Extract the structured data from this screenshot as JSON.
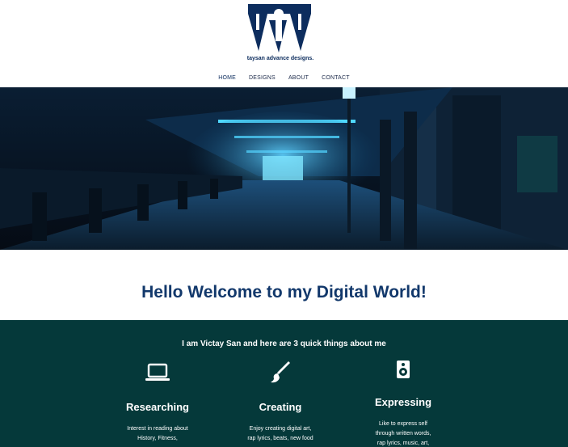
{
  "brand": {
    "name": "taysan advance designs.",
    "primary_color": "#0d2d5e"
  },
  "nav": {
    "items": [
      {
        "label": "HOME"
      },
      {
        "label": "DESIGNS"
      },
      {
        "label": "ABOUT"
      },
      {
        "label": "CONTACT"
      }
    ]
  },
  "hero": {
    "image": "night-corridor-blue-lights"
  },
  "welcome": {
    "title": "Hello Welcome to my Digital World!"
  },
  "about": {
    "intro": "I am Victay San and here are 3 quick things about me",
    "background_color": "#05393a",
    "features": [
      {
        "icon": "laptop-icon",
        "title": "Researching",
        "lines": [
          "Interest in reading about",
          "History, Fitness,",
          "..."
        ]
      },
      {
        "icon": "paintbrush-icon",
        "title": "Creating",
        "lines": [
          "Enjoy creating digital art,",
          "rap lyrics, beats, new food",
          "..."
        ]
      },
      {
        "icon": "speaker-icon",
        "title": "Expressing",
        "lines": [
          "Like to express self",
          "through written words,",
          "rap lyrics, music, art,"
        ]
      }
    ]
  }
}
